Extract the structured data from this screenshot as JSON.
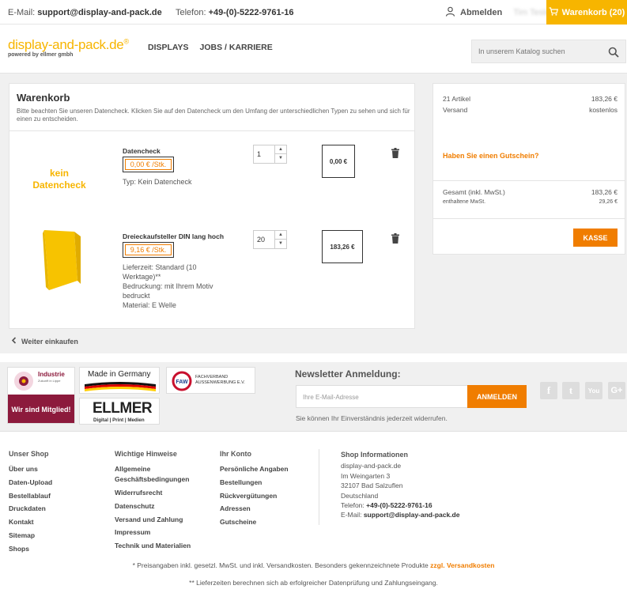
{
  "topbar": {
    "email_label": "E-Mail:",
    "email": "support@display-and-pack.de",
    "phone_label": "Telefon:",
    "phone": "+49-(0)-5222-9761-16",
    "logout": "Abmelden",
    "user_name": "Tim Tester",
    "cart_button": "Warenkorb (20)"
  },
  "header": {
    "logo_name": "display-and-pack.de",
    "logo_reg": "®",
    "logo_sub": "powered by ellmer gmbh",
    "nav": [
      "DISPLAYS",
      "JOBS / KARRIERE"
    ],
    "search_placeholder": "In unserem Katalog suchen"
  },
  "cart": {
    "title": "Warenkorb",
    "note": "Bitte beachten Sie unseren Datencheck. Klicken Sie auf den Datencheck um den Umfang der unterschiedlichen Typen zu sehen und sich für einen zu entscheiden.",
    "items": [
      {
        "image_text": "kein Datencheck",
        "title": "Datencheck",
        "unit_price": "0,00 € /Stk.",
        "info": [
          "Typ: Kein Datencheck"
        ],
        "qty": "1",
        "total": "0,00 €"
      },
      {
        "title": "Dreieckaufsteller DIN lang hoch",
        "unit_price": "9,16 € /Stk.",
        "info": [
          "Lieferzeit: Standard (10",
          "Werktage)**",
          "Bedruckung: mit Ihrem Motiv",
          "bedruckt",
          "Material: E Welle"
        ],
        "qty": "20",
        "total": "183,26 €"
      }
    ],
    "continue": "Weiter einkaufen"
  },
  "summary": {
    "articles_label": "21 Artikel",
    "articles_value": "183,26 €",
    "shipping_label": "Versand",
    "shipping_value": "kostenlos",
    "voucher": "Haben Sie einen Gutschein?",
    "total_label": "Gesamt (inkl. MwSt.)",
    "total_value": "183,26 €",
    "tax_label": "enthaltene MwSt.",
    "tax_value": "29,26 €",
    "checkout": "KASSE"
  },
  "badges": {
    "industrie_title": "Industrie",
    "industrie_sub": "Zukunft in Lippe",
    "industrie_member": "Wir sind Mitglied!",
    "made_in_germany": "Made in Germany",
    "faw": "FAW",
    "faw_text": [
      "FACHVERBAND",
      "AUSSENWERBUNG E.V."
    ],
    "ellmer": "ELLMER",
    "ellmer_sub": "Digital | Print | Medien"
  },
  "newsletter": {
    "title": "Newsletter Anmeldung:",
    "placeholder": "Ihre E-Mail-Adresse",
    "button": "ANMELDEN",
    "note": "Sie können Ihr Einverständnis jederzeit widerrufen."
  },
  "social": [
    "f",
    "t",
    "You",
    "G+"
  ],
  "footer": {
    "shop": {
      "title": "Unser Shop",
      "links": [
        "Über uns",
        "Daten-Upload",
        "Bestellablauf",
        "Druckdaten",
        "Kontakt",
        "Sitemap",
        "Shops"
      ]
    },
    "hints": {
      "title": "Wichtige Hinweise",
      "agb": "Allgemeine Geschäftsbedingungen",
      "links": [
        "Widerrufsrecht",
        "Datenschutz",
        "Versand und Zahlung",
        "Impressum",
        "Technik und Materialien"
      ]
    },
    "account": {
      "title": "Ihr Konto",
      "links": [
        "Persönliche Angaben",
        "Bestellungen",
        "Rückvergütungen",
        "Adressen",
        "Gutscheine"
      ]
    },
    "info": {
      "title": "Shop Informationen",
      "lines": [
        "display-and-pack.de",
        "Im Weingarten 3",
        "32107 Bad Salzuflen",
        "Deutschland"
      ],
      "phone_label": "Telefon:",
      "phone": "+49-(0)-5222-9761-16",
      "email_label": "E-Mail:",
      "email": "support@display-and-pack.de"
    },
    "note1": "* Preisangaben inkl. gesetzl. MwSt. und inkl. Versandkosten. Besonders gekennzeichnete Produkte",
    "note1_link": "zzgl. Versandkosten",
    "note2": "** Lieferzeiten berechnen sich ab erfolgreicher Datenprüfung und Zahlungseingang."
  },
  "colors": {
    "brand_yellow": "#f7b500",
    "accent_orange": "#f07d00",
    "burgundy": "#8c1a3c"
  }
}
